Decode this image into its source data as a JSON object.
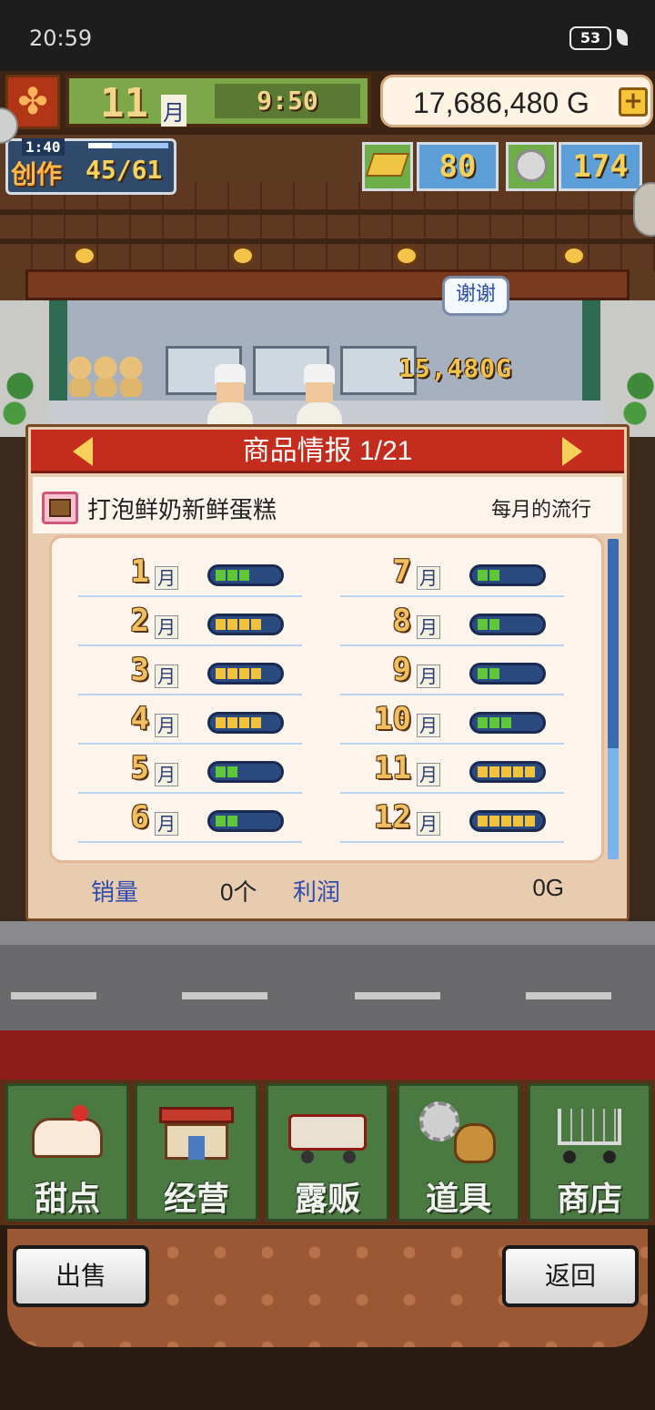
{
  "status_bar": {
    "time": "20:59",
    "battery": "53"
  },
  "hud": {
    "month_number": "11",
    "month_unit": "月",
    "clock": "9:50",
    "money": "17,686,480 G",
    "add_label": "+"
  },
  "creation": {
    "label": "创作",
    "timer": "1:40",
    "count": "45/61",
    "progress": 0.3
  },
  "resources": {
    "gold": "80",
    "medals": "174"
  },
  "scene": {
    "speech": "谢谢",
    "earned": "15,480G"
  },
  "panel": {
    "title": "商品情报 1/21",
    "item_name": "打泡鲜奶新鲜蛋糕",
    "trend_label": "每月的流行",
    "month_unit": "月",
    "months_left": [
      {
        "month": "1",
        "level": 3
      },
      {
        "month": "2",
        "level": 4
      },
      {
        "month": "3",
        "level": 4
      },
      {
        "month": "4",
        "level": 4
      },
      {
        "month": "5",
        "level": 2
      },
      {
        "month": "6",
        "level": 2
      }
    ],
    "months_right": [
      {
        "month": "7",
        "level": 2
      },
      {
        "month": "8",
        "level": 2
      },
      {
        "month": "9",
        "level": 2
      },
      {
        "month": "10",
        "level": 3
      },
      {
        "month": "11",
        "level": 5
      },
      {
        "month": "12",
        "level": 5
      }
    ],
    "sales_label": "销量",
    "sales_value": "0个",
    "profit_label": "利润",
    "profit_value": "0G"
  },
  "menu": [
    {
      "label": "甜点",
      "icon": "cake-icon"
    },
    {
      "label": "经营",
      "icon": "shop-icon"
    },
    {
      "label": "露贩",
      "icon": "food-truck-icon"
    },
    {
      "label": "道具",
      "icon": "gear-bag-icon"
    },
    {
      "label": "商店",
      "icon": "shopping-cart-icon"
    }
  ],
  "footer": {
    "sell_label": "出售",
    "back_label": "返回"
  },
  "colors": {
    "meter_green": "#5fc83a",
    "meter_gold": "#f2c23c",
    "panel_red": "#c42d1e"
  }
}
